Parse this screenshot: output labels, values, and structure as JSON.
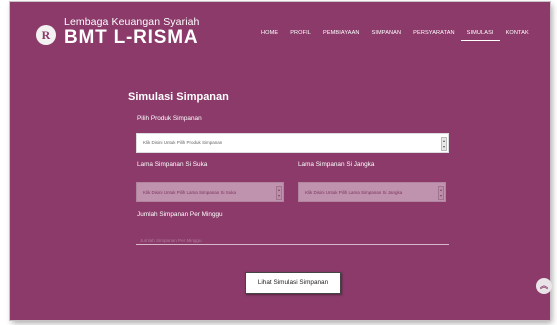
{
  "brand": {
    "logo_letter": "R",
    "sub": "Lembaga Keuangan Syariah",
    "main": "BMT L-RISMA"
  },
  "nav": {
    "items": [
      "HOME",
      "PROFIL",
      "PEMBIAYAAN",
      "SIMPANAN",
      "PERSYARATAN",
      "SIMULASI",
      "KONTAK"
    ],
    "active": "SIMULASI"
  },
  "form": {
    "title": "Simulasi Simpanan",
    "produk_label": "Pilih Produk Simpanan",
    "produk_value": "Klik Disini Untuk Pilih Produk Simpanan",
    "suka_label": "Lama Simpanan Si Suka",
    "suka_placeholder": "Klik Disini Untuk Pilih Lama Simpanan Si Suka",
    "jangka_label": "Lama Simpanan Si Jangka",
    "jangka_placeholder": "Klik Disini Untuk Pilih Lama Simpanan Si Jangka",
    "jumlah_label": "Jumlah Simpanan Per Minggu",
    "jumlah_placeholder": "Jumlah Simpanan Per Minggu",
    "submit_label": "Lihat Simulasi Simpanan"
  },
  "scroll_top_icon": "double-chevron-up-icon",
  "colors": {
    "background": "#8b3a6a",
    "text": "#ffffff"
  }
}
